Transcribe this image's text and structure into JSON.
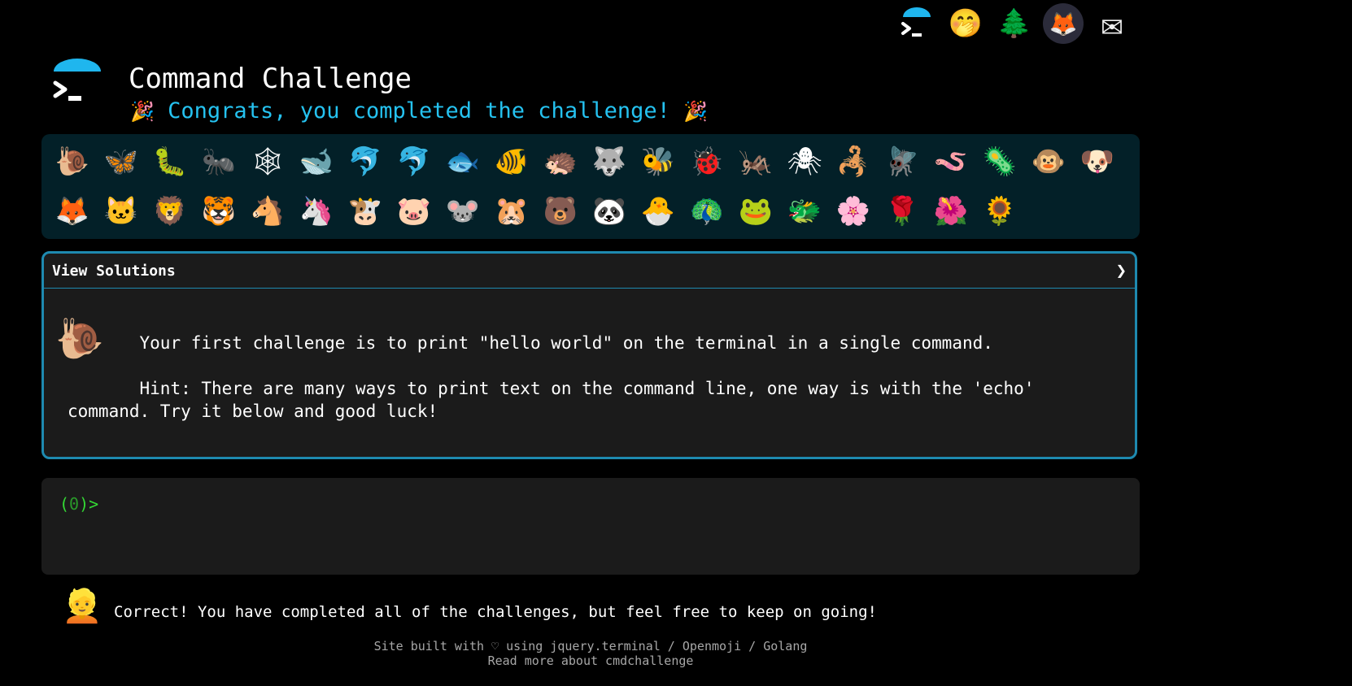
{
  "header": {
    "title": "Command Challenge",
    "congrats": "Congrats, you completed the challenge!",
    "party_icon": "🎉"
  },
  "top_icons": [
    {
      "name": "terminal-logo-icon",
      "glyph": ""
    },
    {
      "name": "face-with-hand-over-mouth-icon",
      "glyph": "🤭"
    },
    {
      "name": "tree-icon",
      "glyph": "🌲"
    },
    {
      "name": "gitlab-icon",
      "glyph": "🦊"
    },
    {
      "name": "envelope-icon",
      "glyph": "✉"
    }
  ],
  "badges": {
    "row1": [
      "🐌",
      "🦋",
      "🐛",
      "🐜",
      "🕸",
      "🐋",
      "🐬",
      "🐬",
      "🐟",
      "🐠",
      "🦔",
      "🐺",
      "🐝",
      "🐞",
      "🦗",
      "🕷",
      "🦂",
      "🪰",
      "🪱",
      "🦠",
      "🐵",
      "🐶"
    ],
    "row2": [
      "🦊",
      "🐱",
      "🦁",
      "🐯",
      "🐴",
      "🦄",
      "🐮",
      "🐷",
      "🐭",
      "🐹",
      "🐻",
      "🐼",
      "🐣",
      "🦚",
      "🐸",
      "🐲",
      "🌸",
      "🌹",
      "🌺",
      "🌻"
    ]
  },
  "solutions": {
    "label": "View Solutions",
    "chevron": "❯",
    "challenge_icon": "🐌",
    "text": "       Your first challenge is to print \"hello world\" on the terminal in a single command.\n\n       Hint: There are many ways to print text on the command line, one way is with the 'echo' command. Try it below and good luck!"
  },
  "terminal": {
    "prompt_open": "(",
    "prompt_num": "0",
    "prompt_close": ")>"
  },
  "response": {
    "icon": "👱",
    "text": "Correct! You have completed all of the challenges, but feel free to keep on going!"
  },
  "footer": {
    "line1": "Site built with ♡ using jquery.terminal / Openmoji / Golang",
    "line2": "Read more about cmdchallenge"
  }
}
